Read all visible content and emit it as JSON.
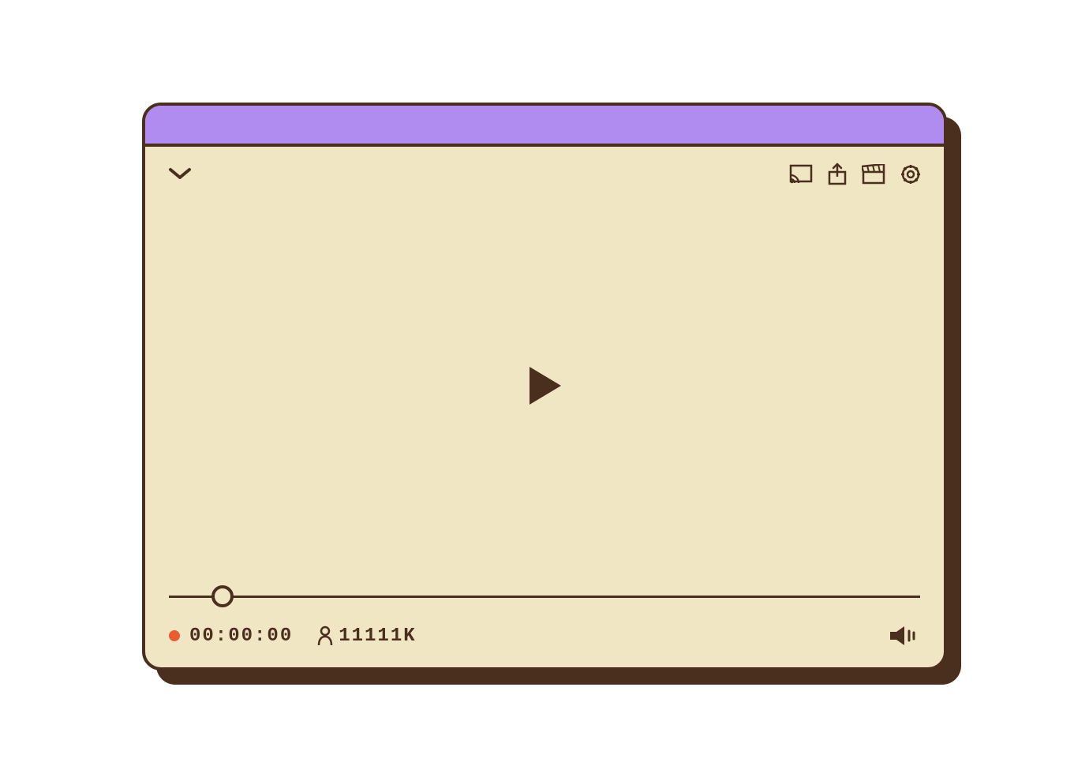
{
  "colors": {
    "accent": "#b08cf0",
    "surface": "#f0e6c4",
    "stroke": "#4a2f1f",
    "live": "#e85c2f"
  },
  "player": {
    "time": "00:00:00",
    "viewers": "11111K",
    "progress_percent": 6
  },
  "icons": {
    "collapse": "chevron-down",
    "cast": "cast",
    "share": "share",
    "clapper": "clapperboard",
    "settings": "gear",
    "play": "play",
    "person": "person",
    "volume": "volume-high"
  }
}
